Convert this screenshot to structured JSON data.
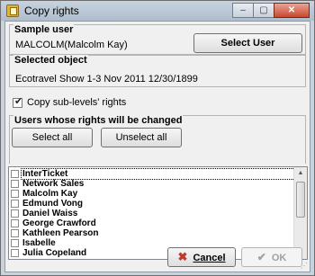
{
  "window": {
    "title": "Copy rights",
    "minimize_label": "–",
    "maximize_label": "▢",
    "close_label": "✕"
  },
  "sample_user": {
    "heading": "Sample user",
    "value": "MALCOLM(Malcolm Kay)",
    "select_button": "Select User"
  },
  "selected_object": {
    "heading": "Selected object",
    "value": "Ecotravel Show 1-3 Nov 2011 12/30/1899"
  },
  "copy_sublevels": {
    "label": "Copy sub-levels' rights",
    "checked": true
  },
  "users_group": {
    "heading": "Users whose rights will be changed",
    "select_all": "Select all",
    "unselect_all": "Unselect all",
    "users": [
      {
        "name": "InterTicket",
        "checked": false,
        "focused": true
      },
      {
        "name": "Network Sales",
        "checked": false
      },
      {
        "name": "Malcolm Kay",
        "checked": false
      },
      {
        "name": "Edmund Vong",
        "checked": false
      },
      {
        "name": "Daniel Waiss",
        "checked": false
      },
      {
        "name": "George Crawford",
        "checked": false
      },
      {
        "name": "Kathleen Pearson",
        "checked": false
      },
      {
        "name": "Isabelle",
        "checked": false
      },
      {
        "name": "Julia Copeland",
        "checked": false
      }
    ]
  },
  "footer": {
    "cancel_label": "Cancel",
    "cancel_hotkey": "C",
    "ok_label": "OK",
    "ok_enabled": false
  },
  "colors": {
    "cancel_icon": "#c0392b",
    "ok_disabled": "#a0a0a0"
  }
}
